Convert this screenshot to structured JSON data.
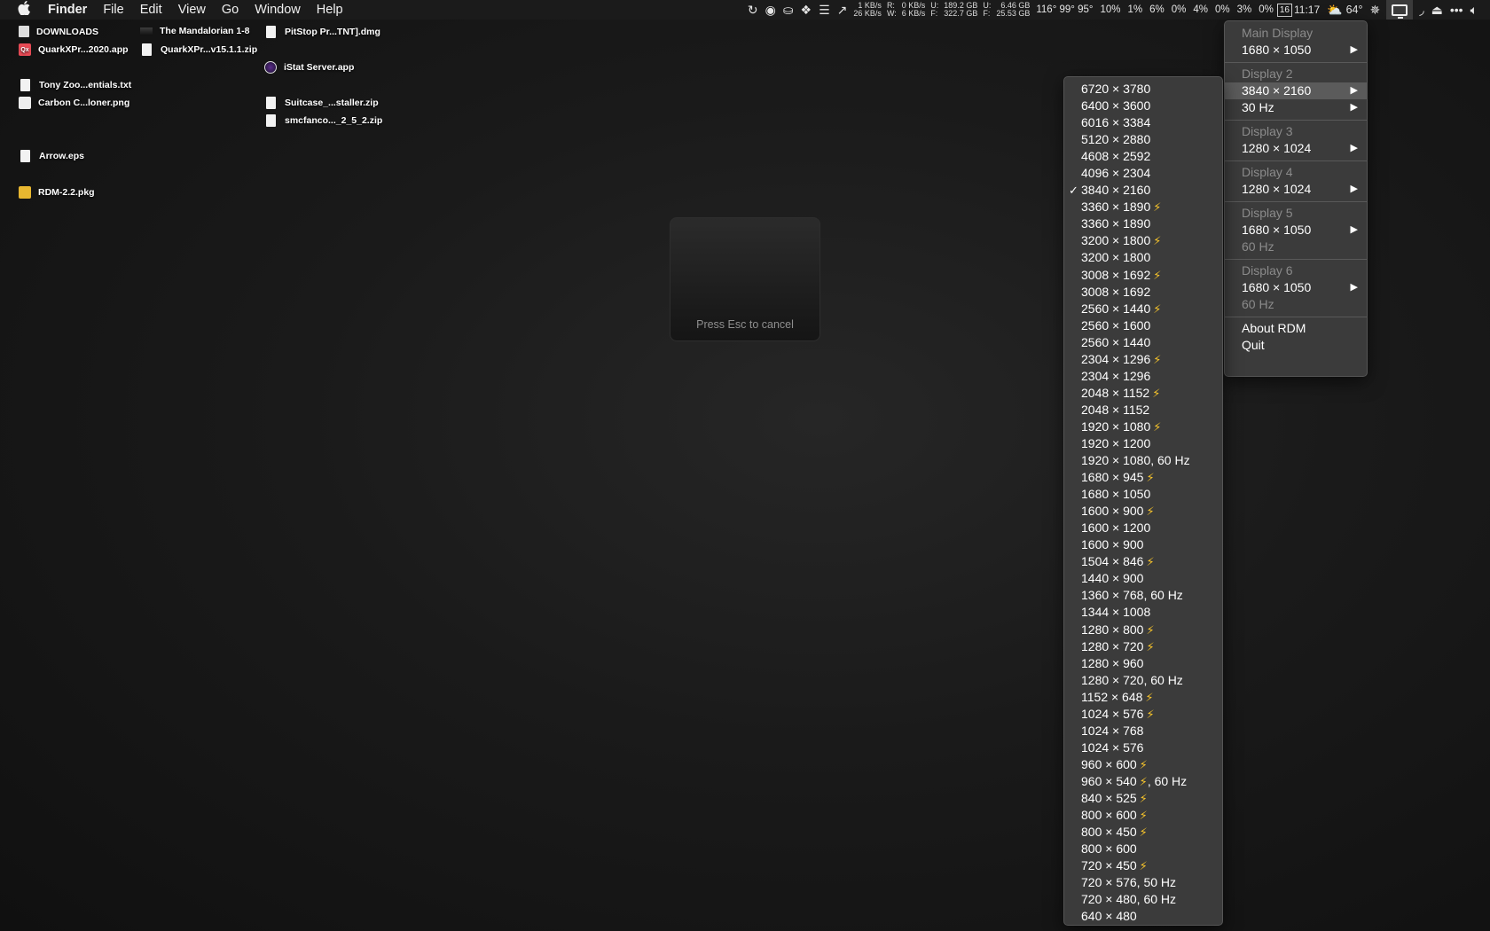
{
  "menubar": {
    "apple": "",
    "menus": [
      "Finder",
      "File",
      "Edit",
      "View",
      "Go",
      "Window",
      "Help"
    ],
    "status": {
      "net_down": "1 KB/s",
      "net_up": "26 KB/s",
      "disk_r_label": "R:",
      "disk_w_label": "W:",
      "disk_r": "0 KB/s",
      "disk_w": "6 KB/s",
      "disk_u_label": "U:",
      "disk_f_label": "F:",
      "disk_used": "189.2 GB",
      "disk_free": "322.7 GB",
      "mem_u_label": "U:",
      "mem_f_label": "F:",
      "mem_used": "6.46 GB",
      "mem_free": "25.53 GB",
      "temps": "116° 99° 95°",
      "cpu": [
        "10%",
        "1%",
        "6%",
        "0%",
        "4%",
        "0%",
        "3%",
        "0%"
      ],
      "date_box": "16",
      "time": "11:17",
      "weather": "64°"
    }
  },
  "desktop": {
    "items": [
      {
        "name": "DOWNLOADS",
        "icon": "folder-icon"
      },
      {
        "name": "QuarkXPr...2020.app",
        "icon": "quark-app-icon"
      },
      {
        "name": "Tony Zoo...entials.txt",
        "icon": "document-icon"
      },
      {
        "name": "Carbon C...loner.png",
        "icon": "image-icon"
      },
      {
        "name": "Arrow.eps",
        "icon": "document-icon"
      },
      {
        "name": "RDM-2.2.pkg",
        "icon": "package-icon"
      },
      {
        "name": "The Mandalorian 1-8",
        "icon": "video-icon"
      },
      {
        "name": "QuarkXPr...v15.1.1.zip",
        "icon": "zip-icon"
      },
      {
        "name": "PitStop Pr...TNT].dmg",
        "icon": "disk-image-icon"
      },
      {
        "name": "iStat Server.app",
        "icon": "istat-app-icon"
      },
      {
        "name": "Suitcase_...staller.zip",
        "icon": "zip-icon"
      },
      {
        "name": "smcfanco..._2_5_2.zip",
        "icon": "zip-icon"
      }
    ]
  },
  "hud": {
    "text": "Press Esc to cancel"
  },
  "display_menu": {
    "main_display": "Main Display",
    "main_res": "1680 × 1050",
    "display2": "Display 2",
    "display2_res": "3840 × 2160",
    "display2_hz": "30 Hz",
    "display3": "Display 3",
    "display3_res": "1280 × 1024",
    "display4": "Display 4",
    "display4_res": "1280 × 1024",
    "display5": "Display 5",
    "display5_res": "1680 × 1050",
    "display5_hz": "60 Hz",
    "display6": "Display 6",
    "display6_res": "1680 × 1050",
    "display6_hz": "60 Hz",
    "about": "About RDM",
    "quit": "Quit"
  },
  "resolution_menu": {
    "selected": "3840 × 2160",
    "items": [
      {
        "label": "6720 × 3780",
        "hidpi": false
      },
      {
        "label": "6400 × 3600",
        "hidpi": false
      },
      {
        "label": "6016 × 3384",
        "hidpi": false
      },
      {
        "label": "5120 × 2880",
        "hidpi": false
      },
      {
        "label": "4608 × 2592",
        "hidpi": false
      },
      {
        "label": "4096 × 2304",
        "hidpi": false
      },
      {
        "label": "3840 × 2160",
        "hidpi": false,
        "checked": true
      },
      {
        "label": "3360 × 1890",
        "hidpi": true
      },
      {
        "label": "3360 × 1890",
        "hidpi": false
      },
      {
        "label": "3200 × 1800",
        "hidpi": true
      },
      {
        "label": "3200 × 1800",
        "hidpi": false
      },
      {
        "label": "3008 × 1692",
        "hidpi": true
      },
      {
        "label": "3008 × 1692",
        "hidpi": false
      },
      {
        "label": "2560 × 1440",
        "hidpi": true
      },
      {
        "label": "2560 × 1600",
        "hidpi": false
      },
      {
        "label": "2560 × 1440",
        "hidpi": false
      },
      {
        "label": "2304 × 1296",
        "hidpi": true
      },
      {
        "label": "2304 × 1296",
        "hidpi": false
      },
      {
        "label": "2048 × 1152",
        "hidpi": true
      },
      {
        "label": "2048 × 1152",
        "hidpi": false
      },
      {
        "label": "1920 × 1080",
        "hidpi": true
      },
      {
        "label": "1920 × 1200",
        "hidpi": false
      },
      {
        "label": "1920 × 1080, 60 Hz",
        "hidpi": false
      },
      {
        "label": "1680 × 945",
        "hidpi": true
      },
      {
        "label": "1680 × 1050",
        "hidpi": false
      },
      {
        "label": "1600 × 900",
        "hidpi": true
      },
      {
        "label": "1600 × 1200",
        "hidpi": false
      },
      {
        "label": "1600 × 900",
        "hidpi": false
      },
      {
        "label": "1504 × 846",
        "hidpi": true
      },
      {
        "label": "1440 × 900",
        "hidpi": false
      },
      {
        "label": "1360 × 768, 60 Hz",
        "hidpi": false
      },
      {
        "label": "1344 × 1008",
        "hidpi": false
      },
      {
        "label": "1280 × 800",
        "hidpi": true
      },
      {
        "label": "1280 × 720",
        "hidpi": true
      },
      {
        "label": "1280 × 960",
        "hidpi": false
      },
      {
        "label": "1280 × 720, 60 Hz",
        "hidpi": false
      },
      {
        "label": "1152 × 648",
        "hidpi": true
      },
      {
        "label": "1024 × 576",
        "hidpi": true
      },
      {
        "label": "1024 × 768",
        "hidpi": false
      },
      {
        "label": "1024 × 576",
        "hidpi": false
      },
      {
        "label": "960 × 600",
        "hidpi": true
      },
      {
        "label": "960 × 540",
        "hidpi": true,
        "suffix": ", 60 Hz"
      },
      {
        "label": "840 × 525",
        "hidpi": true
      },
      {
        "label": "800 × 600",
        "hidpi": true
      },
      {
        "label": "800 × 450",
        "hidpi": true
      },
      {
        "label": "800 × 600",
        "hidpi": false
      },
      {
        "label": "720 × 450",
        "hidpi": true
      },
      {
        "label": "720 × 576, 50 Hz",
        "hidpi": false
      },
      {
        "label": "720 × 480, 60 Hz",
        "hidpi": false
      },
      {
        "label": "640 × 480",
        "hidpi": false
      }
    ]
  },
  "colors": {
    "bolt": "#f7c42b",
    "menu_bg": "#3b3b3b",
    "highlight": "#5b5b5b"
  }
}
